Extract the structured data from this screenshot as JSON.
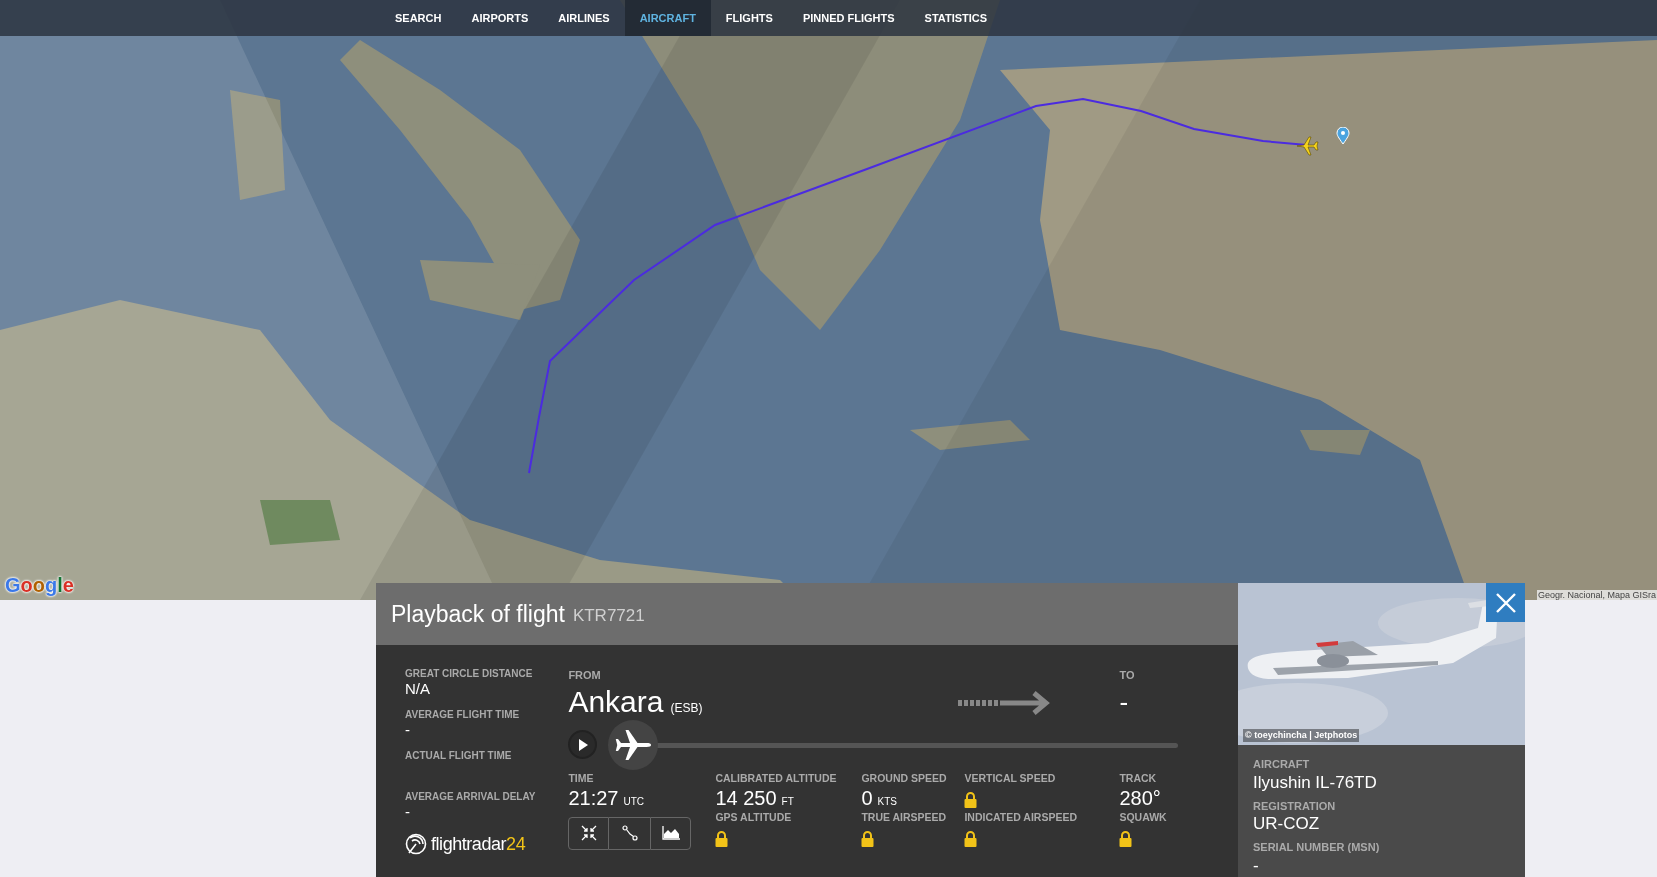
{
  "nav": [
    {
      "label": "SEARCH",
      "selected": false
    },
    {
      "label": "AIRPORTS",
      "selected": false
    },
    {
      "label": "AIRLINES",
      "selected": false
    },
    {
      "label": "AIRCRAFT",
      "selected": true
    },
    {
      "label": "FLIGHTS",
      "selected": false
    },
    {
      "label": "PINNED FLIGHTS",
      "selected": false
    },
    {
      "label": "STATISTICS",
      "selected": false
    }
  ],
  "map": {
    "logo": "Google",
    "attribution": "Geogr. Nacional, Mapa GISra"
  },
  "panel": {
    "title": "Playback of flight",
    "callsign": "KTR7721",
    "stats": [
      {
        "label": "GREAT CIRCLE DISTANCE",
        "value": "N/A"
      },
      {
        "label": "AVERAGE FLIGHT TIME",
        "value": "-"
      },
      {
        "label": "ACTUAL FLIGHT TIME"
      },
      {
        "label": "AVERAGE ARRIVAL DELAY",
        "value": "-"
      }
    ],
    "logo": {
      "text": "flightradar",
      "suffix": "24"
    },
    "from": {
      "label": "FROM",
      "city": "Ankara",
      "code": "(ESB)"
    },
    "to": {
      "label": "TO",
      "city": "-"
    },
    "playback": {
      "level": 0
    },
    "time": {
      "label": "TIME",
      "value": "21:27",
      "unit": "UTC"
    },
    "fields": [
      {
        "label": "CALIBRATED ALTITUDE",
        "value": "14 250",
        "unit": "FT",
        "locked": false
      },
      {
        "label": "GROUND SPEED",
        "value": "0",
        "unit": "KTS",
        "locked": false
      },
      {
        "label": "VERTICAL SPEED",
        "locked": true
      },
      {
        "label": "TRACK",
        "value": "280°",
        "locked": false
      },
      {
        "label": "GPS ALTITUDE",
        "locked": true
      },
      {
        "label": "TRUE AIRSPEED",
        "locked": true
      },
      {
        "label": "INDICATED AIRSPEED",
        "locked": true
      },
      {
        "label": "SQUAWK",
        "locked": true
      }
    ],
    "photo": {
      "credit": "© toeychincha | Jetphotos"
    },
    "aircraft": [
      {
        "label": "AIRCRAFT",
        "value": "Ilyushin IL-76TD"
      },
      {
        "label": "REGISTRATION",
        "value": "UR-COZ"
      },
      {
        "label": "SERIAL NUMBER (MSN)",
        "value": "-"
      }
    ]
  }
}
